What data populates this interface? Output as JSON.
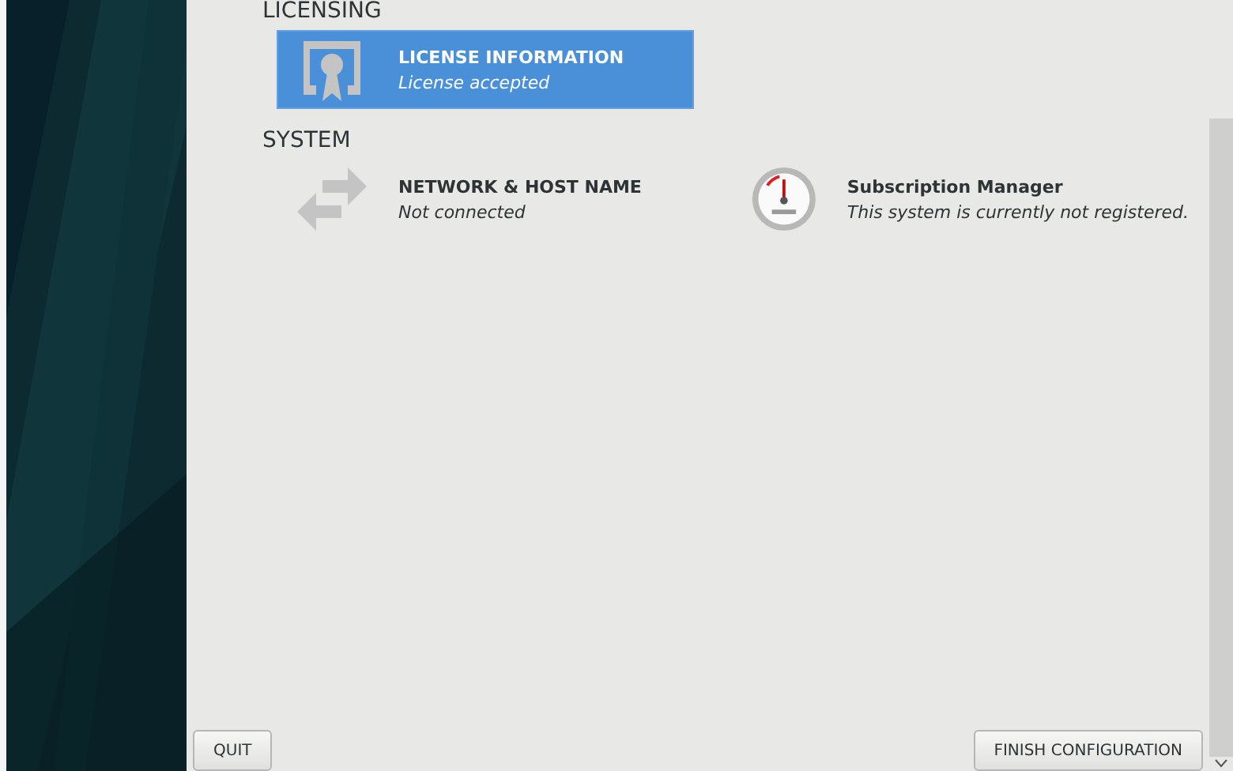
{
  "sections": [
    {
      "title": "LICENSING",
      "spokes": [
        {
          "kind": "license",
          "title": "LICENSE INFORMATION",
          "status": "License accepted",
          "selected": true
        }
      ]
    },
    {
      "title": "SYSTEM",
      "spokes": [
        {
          "kind": "network",
          "title": "NETWORK & HOST NAME",
          "status": "Not connected",
          "selected": false
        },
        {
          "kind": "gauge",
          "title": "Subscription Manager",
          "status": "This system is currently not registered.",
          "selected": false
        }
      ]
    }
  ],
  "buttons": {
    "quit": "QUIT",
    "finish": "FINISH CONFIGURATION"
  }
}
